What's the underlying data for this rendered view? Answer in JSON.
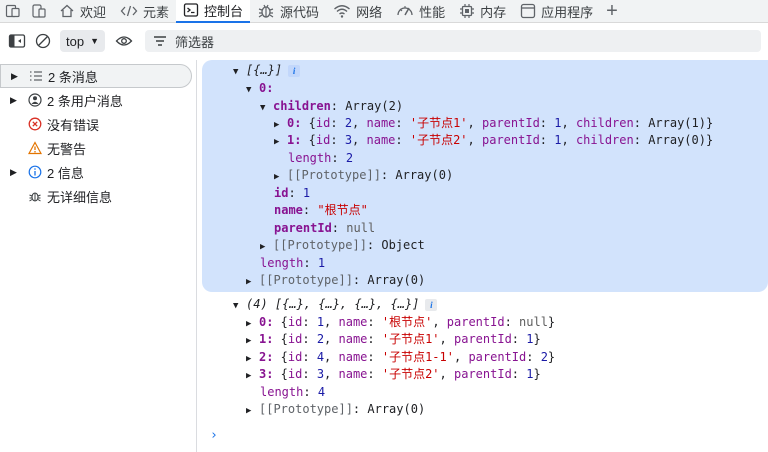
{
  "tabs": [
    {
      "label": "欢迎",
      "icon": "home-icon"
    },
    {
      "label": "元素",
      "icon": "code-icon"
    },
    {
      "label": "控制台",
      "icon": "console-icon",
      "active": true
    },
    {
      "label": "源代码",
      "icon": "bug-icon"
    },
    {
      "label": "网络",
      "icon": "wifi-icon"
    },
    {
      "label": "性能",
      "icon": "performance-icon"
    },
    {
      "label": "内存",
      "icon": "memory-icon"
    },
    {
      "label": "应用程序",
      "icon": "application-icon"
    }
  ],
  "toolbar": {
    "context": "top",
    "filter_placeholder": "筛选器"
  },
  "sidebar": {
    "items": [
      {
        "label": "2 条消息",
        "icon": "list-icon",
        "expandable": true
      },
      {
        "label": "2 条用户消息",
        "icon": "user-icon",
        "expandable": true
      },
      {
        "label": "没有错误",
        "icon": "error-icon",
        "expandable": false
      },
      {
        "label": "无警告",
        "icon": "warning-icon",
        "expandable": false
      },
      {
        "label": "2 信息",
        "icon": "info-icon",
        "expandable": true
      },
      {
        "label": "无详细信息",
        "icon": "verbose-icon",
        "expandable": false
      }
    ]
  },
  "console": {
    "line1": "[{…}]",
    "line2": "0:",
    "children_key": "children",
    "children_val": "Array(2)",
    "c0_idx": "0:",
    "c0_id": "2",
    "c0_name": "'子节点1'",
    "c0_pid": "1",
    "c0_children": "Array(1)",
    "c1_idx": "1:",
    "c1_id": "3",
    "c1_name": "'子节点2'",
    "c1_pid": "1",
    "c1_children": "Array(0)",
    "inner_length": "2",
    "inner_proto": "Array(0)",
    "id_val": "1",
    "name_val": "\"根节点\"",
    "pid_val": "null",
    "obj_proto": "Object",
    "outer_length": "1",
    "outer_proto": "Array(0)",
    "log2_head": "(4) [{…}, {…}, {…}, {…}]",
    "r0_idx": "0:",
    "r0_id": "1",
    "r0_name": "'根节点'",
    "r0_pid": "null",
    "r1_idx": "1:",
    "r1_id": "2",
    "r1_name": "'子节点1'",
    "r1_pid": "1",
    "r2_idx": "2:",
    "r2_id": "4",
    "r2_name": "'子节点1-1'",
    "r2_pid": "2",
    "r3_idx": "3:",
    "r3_id": "3",
    "r3_name": "'子节点2'",
    "r3_pid": "1",
    "log2_length": "4",
    "log2_proto": "Array(0)"
  },
  "colors": {
    "accent": "#1a73e8",
    "highlight": "#d2e3fc",
    "key": "#881391",
    "string": "#c80000",
    "number": "#1a1aa6"
  }
}
